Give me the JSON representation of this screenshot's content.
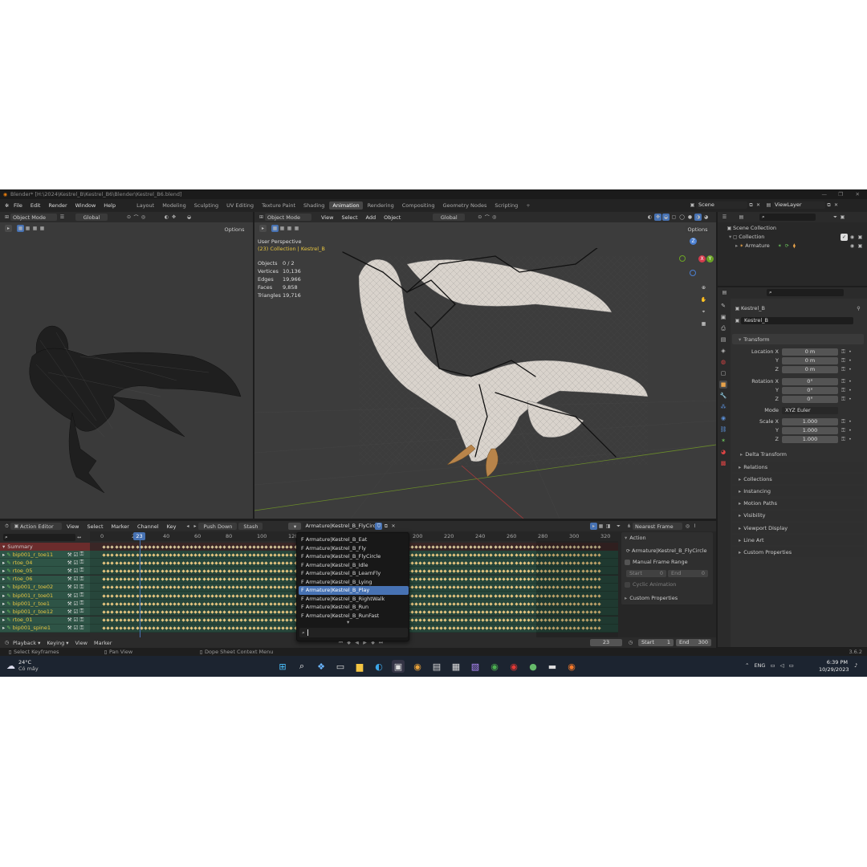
{
  "window": {
    "title": "Blender* [H:\\2024\\Kestrel_B\\Kestrel_B6\\Blender\\Kestrel_B6.blend]"
  },
  "menu": [
    "File",
    "Edit",
    "Render",
    "Window",
    "Help"
  ],
  "workspaces": [
    "Layout",
    "Modeling",
    "Sculpting",
    "UV Editing",
    "Texture Paint",
    "Shading",
    "Animation",
    "Rendering",
    "Compositing",
    "Geometry Nodes",
    "Scripting"
  ],
  "active_workspace": "Animation",
  "scene": {
    "scene_name": "Scene",
    "view_layer": "ViewLayer"
  },
  "left_viewport": {
    "mode": "Object Mode",
    "orientation": "Global",
    "options": "Options"
  },
  "main_viewport": {
    "mode": "Object Mode",
    "menu": [
      "View",
      "Select",
      "Add",
      "Object"
    ],
    "orientation": "Global",
    "options": "Options",
    "perspective": "User Perspective",
    "collection_line": "(23) Collection | Kestrel_B",
    "stats": [
      {
        "label": "Objects",
        "value": "0 / 2"
      },
      {
        "label": "Vertices",
        "value": "10,136"
      },
      {
        "label": "Edges",
        "value": "19,966"
      },
      {
        "label": "Faces",
        "value": "9,858"
      },
      {
        "label": "Triangles",
        "value": "19,716"
      }
    ],
    "gizmo": {
      "x": "X",
      "y": "Y",
      "z": "Z"
    }
  },
  "outliner": {
    "scene_collection": "Scene Collection",
    "collection": "Collection",
    "armature": "Armature"
  },
  "properties": {
    "object_name": "Kestrel_B",
    "object_field": "Kestrel_B",
    "transform_title": "Transform",
    "location": [
      {
        "label": "Location X",
        "value": "0 m"
      },
      {
        "label": "Y",
        "value": "0 m"
      },
      {
        "label": "Z",
        "value": "0 m"
      }
    ],
    "rotation": [
      {
        "label": "Rotation X",
        "value": "0°"
      },
      {
        "label": "Y",
        "value": "0°"
      },
      {
        "label": "Z",
        "value": "0°"
      }
    ],
    "mode_label": "Mode",
    "mode_value": "XYZ Euler",
    "scale": [
      {
        "label": "Scale X",
        "value": "1.000"
      },
      {
        "label": "Y",
        "value": "1.000"
      },
      {
        "label": "Z",
        "value": "1.000"
      }
    ],
    "delta_transform": "Delta Transform",
    "sections": [
      "Relations",
      "Collections",
      "Instancing",
      "Motion Paths",
      "Visibility",
      "Viewport Display",
      "Line Art",
      "Custom Properties"
    ]
  },
  "dope_sheet": {
    "editor": "Action Editor",
    "menu": [
      "View",
      "Select",
      "Marker",
      "Channel",
      "Key"
    ],
    "push_down": "Push Down",
    "stash": "Stash",
    "action_name": "Armature|Kestrel_B_FlyCircle",
    "snap": "Nearest Frame",
    "frame_ticks": [
      "0",
      "20",
      "40",
      "60",
      "80",
      "100",
      "120",
      "200",
      "220",
      "240",
      "260",
      "280",
      "300",
      "320"
    ],
    "current_frame_badge": "23",
    "summary": "Summary",
    "channels": [
      "bip001_r_toe11",
      "rtoe_04",
      "rtoe_05",
      "rtoe_06",
      "bip001_r_toe02",
      "bip001_r_toe01",
      "bip001_r_toe1",
      "bip001_r_toe12",
      "rtoe_01",
      "bip001_spine1"
    ]
  },
  "action_dropdown": {
    "items": [
      "Armature|Kestrel_B_Eat",
      "Armature|Kestrel_B_Fly",
      "Armature|Kestrel_B_FlyCircle",
      "Armature|Kestrel_B_Idle",
      "Armature|Kestrel_B_LearnFly",
      "Armature|Kestrel_B_Lying",
      "Armature|Kestrel_B_Play",
      "Armature|Kestrel_B_RightWalk",
      "Armature|Kestrel_B_Run",
      "Armature|Kestrel_B_RunFast"
    ],
    "prefix": "F",
    "highlighted_index": 6
  },
  "action_panel": {
    "title": "Action",
    "action": "Armature|Kestrel_B_FlyCircle",
    "manual_range": "Manual Frame Range",
    "start_label": "Start",
    "start_value": "0",
    "end_label": "End",
    "end_value": "0",
    "cyclic": "Cyclic Animation",
    "custom_props": "Custom Properties"
  },
  "timeline": {
    "playback": "Playback",
    "keying": "Keying",
    "view": "View",
    "marker": "Marker",
    "current": "23",
    "start_label": "Start",
    "start": "1",
    "end_label": "End",
    "end": "300"
  },
  "status_bar": {
    "select": "Select Keyframes",
    "pan": "Pan View",
    "context": "Dope Sheet Context Menu",
    "version": "3.6.2"
  },
  "taskbar": {
    "weather_temp": "24°C",
    "weather_text": "Có mây",
    "lang": "ENG",
    "time": "6:39 PM",
    "date": "10/29/2023"
  },
  "colors": {
    "accent": "#4772b3",
    "keyframe": "#e8c680",
    "channel_green": "#2f5a4a",
    "summary_red": "#6b2c2c",
    "frame_blue": "#4772b3"
  }
}
